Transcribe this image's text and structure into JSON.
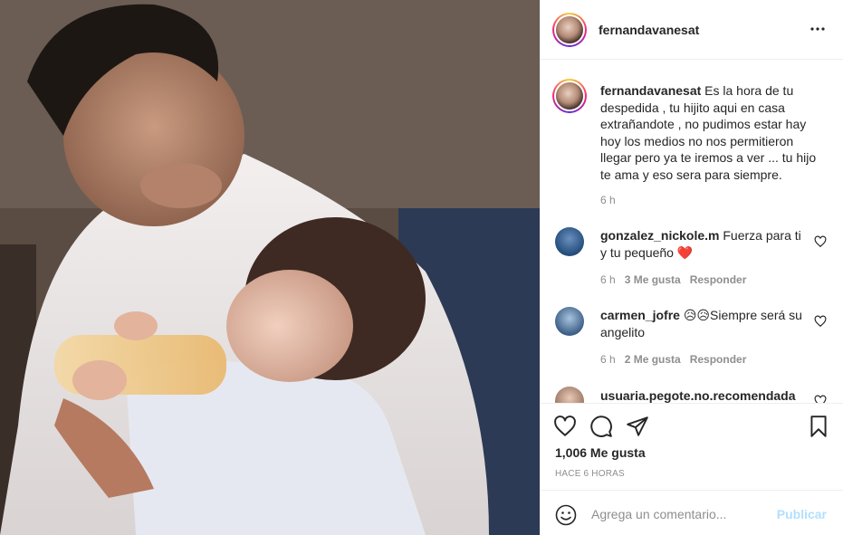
{
  "colors": {
    "border": "#efefef",
    "muted": "#8e8e8e",
    "text": "#262626",
    "post_disabled": "#b2dffc",
    "heart": "#e0245e"
  },
  "photo": {
    "description_icon": "photo"
  },
  "header": {
    "username": "fernandavanesat"
  },
  "caption": {
    "username": "fernandavanesat",
    "text": "Es la hora de tu despedida , tu hijito aqui en casa extrañandote , no pudimos estar hay hoy los medios no nos permitieron llegar pero ya te iremos a ver ... tu hijo te ama y eso sera para siempre.",
    "time": "6 h"
  },
  "comments": [
    {
      "username": "gonzalez_nickole.m",
      "text": "Fuerza para ti y tu pequeño ❤️",
      "time": "6 h",
      "likes": "3 Me gusta",
      "reply": "Responder"
    },
    {
      "username": "carmen_jofre",
      "text": "😥😥Siempre será su angelito",
      "time": "6 h",
      "likes": "2 Me gusta",
      "reply": "Responder"
    },
    {
      "username": "usuaria.pegote.no.recomendada",
      "text": "",
      "time": "",
      "likes": "",
      "reply": ""
    }
  ],
  "actions": {
    "likes": "1,006 Me gusta",
    "timestamp": "HACE 6 HORAS"
  },
  "add_comment": {
    "placeholder": "Agrega un comentario...",
    "post_label": "Publicar"
  }
}
